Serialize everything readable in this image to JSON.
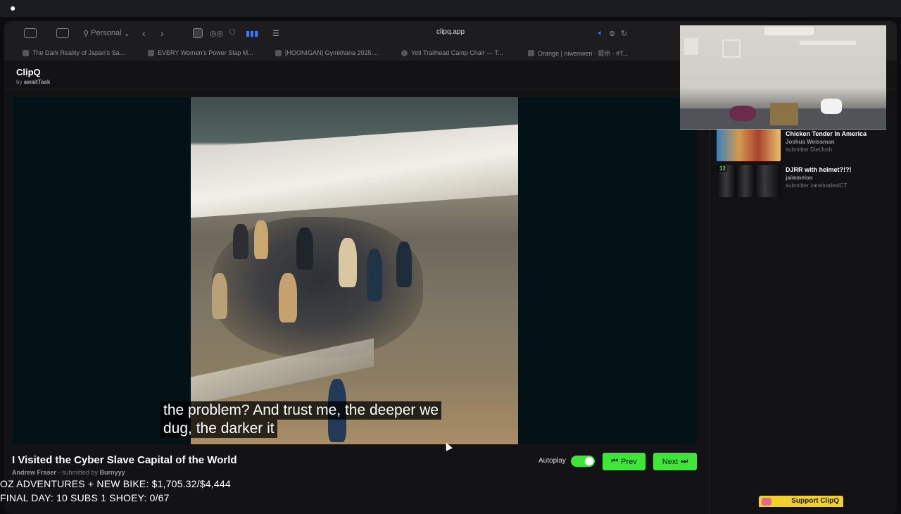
{
  "menubar": {
    "apple": ""
  },
  "browser": {
    "profile": "Personal",
    "url": "clipq.app",
    "tabs": [
      "The Dark Reality of Japan's Sa...",
      "EVERY Women's Power Slap M...",
      "[HOONIGAN] Gymkhana 2025:...",
      "Yeti Trailhead Camp Chair — T...",
      "Orange | niwenwen · 提示 · #T..."
    ]
  },
  "app": {
    "name": "ClipQ",
    "by_prefix": "by",
    "by_name": "awaitTask"
  },
  "video": {
    "subtitle_line1": "the problem? And trust me, the deeper we",
    "subtitle_line2": "dug, the darker it",
    "title": "I Visited the Cyber Slave Capital of the World",
    "channel": "Andrew Fraser",
    "separator": " - submitted by ",
    "submitter": "Burnyyy"
  },
  "controls": {
    "autoplay_label": "Autoplay",
    "autoplay_on": true,
    "prev_label": "Prev",
    "next_label": "Next"
  },
  "related": [
    {
      "title": "Chicken Tender In America",
      "channel": "Joshua Weissman",
      "submitter": "submitter DietJosh",
      "badge": ""
    },
    {
      "title": "DJRR with helmet?!?!",
      "channel": "jaiwmelon",
      "submitter": "submitter zanetradesICT",
      "badge": "32"
    }
  ],
  "stream_overlay": {
    "line1": "OZ ADVENTURES + NEW BIKE: $1,705.32/$4,444",
    "line2": "FINAL DAY: 10 SUBS 1 SHOEY: 0/67"
  },
  "support_label": "Support ClipQ",
  "colors": {
    "accent": "#3ee63a",
    "player_bg": "#031217",
    "page_bg": "#131315"
  }
}
